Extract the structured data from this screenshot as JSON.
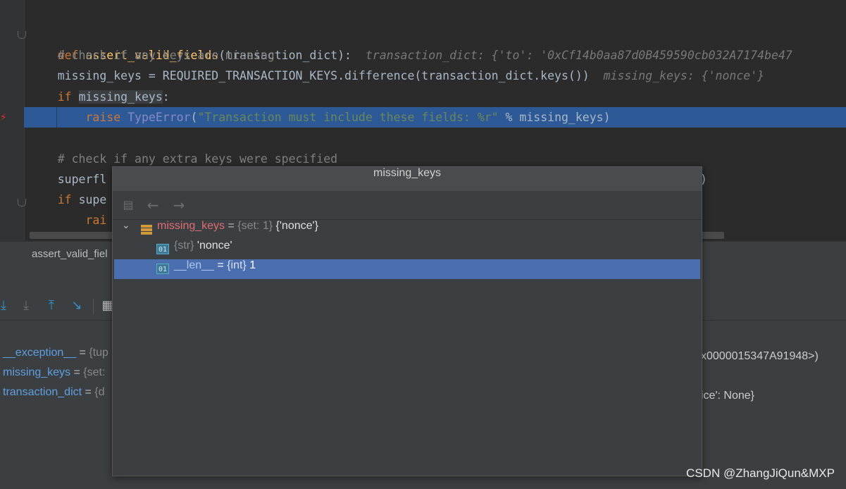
{
  "editor": {
    "line1": {
      "kw": "def",
      "fn": "assert_valid_fields",
      "params": "(transaction_dict):",
      "hint": "transaction_dict: {'to': '0xCf14b0aa87d0B459590cb032A7174be47"
    },
    "line2": "# check if any keys are missing",
    "line3": {
      "code": "missing_keys = REQUIRED_TRANSACTION_KEYS.difference(transaction_dict.keys())",
      "hint": "missing_keys: {'nonce'}"
    },
    "line4": {
      "kw": "if",
      "var": "missing_keys",
      "tail": ":"
    },
    "line5": {
      "kw": "raise",
      "cls": "TypeError",
      "open": "(",
      "str": "\"Transaction must include these fields: %r\"",
      "tail": " % missing_keys)"
    },
    "line7": "# check if any extra keys were specified",
    "line8": {
      "code": "superfl",
      "tail": ")"
    },
    "line9": {
      "kw": "if",
      "code": "supe"
    },
    "line10": {
      "kw": "rai"
    }
  },
  "breadcrumb": "assert_valid_fiel",
  "variables": [
    {
      "name": "__exception__",
      "eq": " = ",
      "type": "{tup",
      "right": "x0000015347A91948>)"
    },
    {
      "name": "missing_keys",
      "eq": " = ",
      "type": "{set:",
      "right": ""
    },
    {
      "name": "transaction_dict",
      "eq": " = ",
      "type": "{d",
      "right": "ice': None}"
    }
  ],
  "popup": {
    "title": "missing_keys",
    "tree": [
      {
        "chevron": "⌄",
        "name": "missing_keys",
        "eq": " = ",
        "type": "{set: 1} ",
        "value": "{'nonce'}"
      },
      {
        "icon": "01",
        "name": "",
        "eq": "",
        "type": "{str} ",
        "value": "'nonce'"
      },
      {
        "icon": "01",
        "name": "__len__",
        "eq": " = ",
        "type": "{int} ",
        "value": "1"
      }
    ]
  },
  "watermark": "CSDN @ZhangJiQun&MXP",
  "icons": [
    "fold-icon",
    "breakpoint-bolt-icon",
    "step-over-icon",
    "step-into-icon",
    "step-out-icon",
    "run-to-cursor-icon",
    "evaluate-table-icon",
    "back-arrow-icon",
    "forward-arrow-icon",
    "set-icon",
    "primitive-icon",
    "chevron-down-icon"
  ],
  "colors": {
    "highlight": "#2d5a97",
    "selection": "#4b6eaf",
    "keyword": "#cc7832",
    "function": "#ffc66d",
    "string": "#6a8759"
  }
}
